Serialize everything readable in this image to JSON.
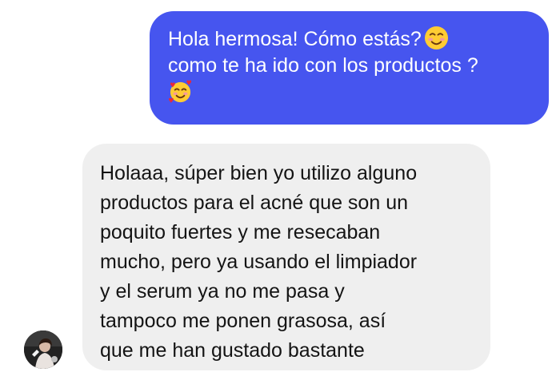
{
  "conversation": {
    "outgoing": {
      "lines": [
        "Hola hermosa! Cómo estás?",
        "como te ha ido con los productos ?"
      ],
      "emojis": [
        "smiling-face-icon",
        "smiling-face-with-hearts-icon"
      ]
    },
    "incoming": {
      "lines": [
        "Holaaa, súper bien yo utilizo alguno",
        "productos para el acné que son un",
        "poquito fuertes y me resecaban",
        "mucho, pero ya usando el limpiador",
        "y el serum ya no me pasa y",
        "tampoco me ponen grasosa, así",
        "que me han gustado bastante"
      ]
    }
  },
  "colors": {
    "outgoing_bubble": "#4655ef",
    "incoming_bubble": "#efefef",
    "outgoing_text": "#ffffff",
    "incoming_text": "#141414"
  }
}
